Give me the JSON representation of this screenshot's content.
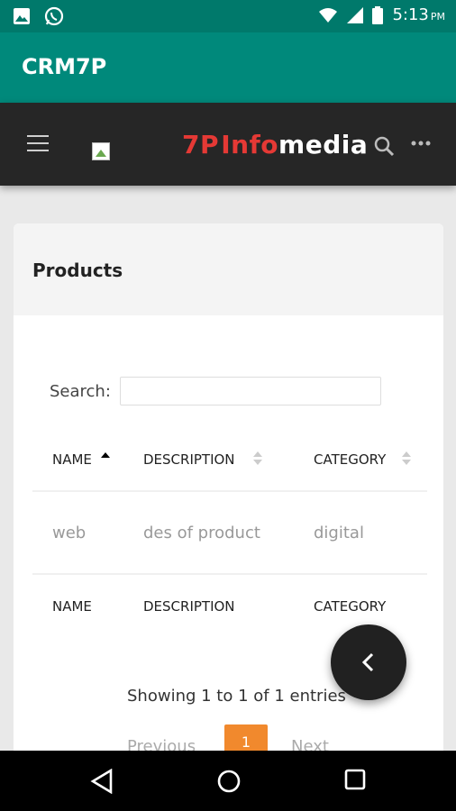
{
  "status_bar": {
    "time": "5:13",
    "ampm": "PM",
    "left_icons": [
      "image-icon",
      "whatsapp-icon"
    ],
    "right_icons": [
      "wifi-icon",
      "signal-icon",
      "battery-icon"
    ]
  },
  "app_bar": {
    "title": "CRM7P"
  },
  "web_header": {
    "brand": {
      "part1": "7P",
      "part2": "Info",
      "part3": "media"
    },
    "colors": {
      "red": "#e53935",
      "background": "#262626"
    }
  },
  "card": {
    "title": "Products",
    "search_label": "Search:",
    "search_value": "",
    "table": {
      "columns": [
        "NAME",
        "DESCRIPTION",
        "CATEGORY"
      ],
      "rows": [
        {
          "name": "web",
          "description": "des of product",
          "category": "digital"
        }
      ],
      "footer_columns": [
        "NAME",
        "DESCRIPTION",
        "CATEGORY"
      ]
    },
    "info": "Showing 1 to 1 of 1 entries",
    "pagination": {
      "previous": "Previous",
      "current": "1",
      "next": "Next",
      "accent": "#f1892d"
    }
  },
  "nav_bar": {
    "icons": [
      "back-icon",
      "home-icon",
      "recents-icon"
    ]
  }
}
